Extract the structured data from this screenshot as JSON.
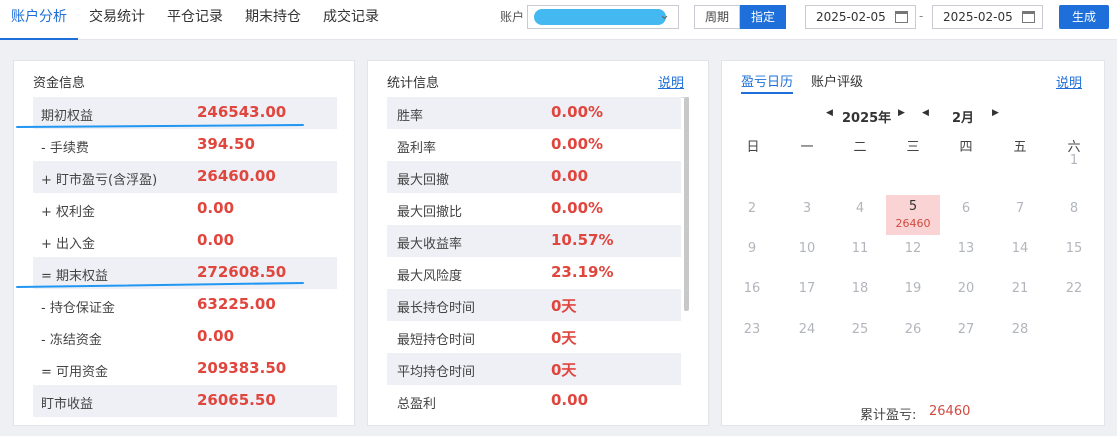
{
  "tabs": [
    "账户分析",
    "交易统计",
    "平仓记录",
    "期末持仓",
    "成交记录"
  ],
  "account": {
    "label": "账户",
    "value_visible": ""
  },
  "period_buttons": {
    "cycle": "周期",
    "specified": "指定"
  },
  "date_start": "2025-02-05",
  "date_end": "2025-02-05",
  "date_separator": "-",
  "generate_label": "生成",
  "funds": {
    "title": "资金信息",
    "rows": [
      {
        "label": "期初权益",
        "value": "246543.00"
      },
      {
        "label": "- 手续费",
        "value": "394.50"
      },
      {
        "label": "+ 盯市盈亏(含浮盈)",
        "value": "26460.00"
      },
      {
        "label": "+ 权利金",
        "value": "0.00"
      },
      {
        "label": "+ 出入金",
        "value": "0.00"
      },
      {
        "label": "= 期末权益",
        "value": "272608.50"
      },
      {
        "label": "- 持仓保证金",
        "value": "63225.00"
      },
      {
        "label": "- 冻结资金",
        "value": "0.00"
      },
      {
        "label": "= 可用资金",
        "value": "209383.50"
      },
      {
        "label": "盯市收益",
        "value": "26065.50"
      }
    ]
  },
  "stats": {
    "title": "统计信息",
    "explain": "说明",
    "rows": [
      {
        "label": "胜率",
        "value": "0.00%"
      },
      {
        "label": "盈利率",
        "value": "0.00%"
      },
      {
        "label": "最大回撤",
        "value": "0.00"
      },
      {
        "label": "最大回撤比",
        "value": "0.00%"
      },
      {
        "label": "最大收益率",
        "value": "10.57%"
      },
      {
        "label": "最大风险度",
        "value": "23.19%"
      },
      {
        "label": "最长持仓时间",
        "value": "0天"
      },
      {
        "label": "最短持仓时间",
        "value": "0天"
      },
      {
        "label": "平均持仓时间",
        "value": "0天"
      },
      {
        "label": "总盈利",
        "value": "0.00"
      }
    ]
  },
  "calendar": {
    "tabs": [
      "盈亏日历",
      "账户评级"
    ],
    "explain": "说明",
    "year": "2025年",
    "month": "2月",
    "weekdays": [
      "日",
      "一",
      "二",
      "三",
      "四",
      "五",
      "六"
    ],
    "weeks": [
      [
        "",
        "",
        "",
        "",
        "",
        "",
        "1"
      ],
      [
        "2",
        "3",
        "4",
        "5",
        "6",
        "7",
        "8"
      ],
      [
        "9",
        "10",
        "11",
        "12",
        "13",
        "14",
        "15"
      ],
      [
        "16",
        "17",
        "18",
        "19",
        "20",
        "21",
        "22"
      ],
      [
        "23",
        "24",
        "25",
        "26",
        "27",
        "28",
        ""
      ]
    ],
    "highlight": {
      "day": "5",
      "pnl": "26460"
    },
    "total_label": "累计盈亏:",
    "total_value": "26460"
  }
}
